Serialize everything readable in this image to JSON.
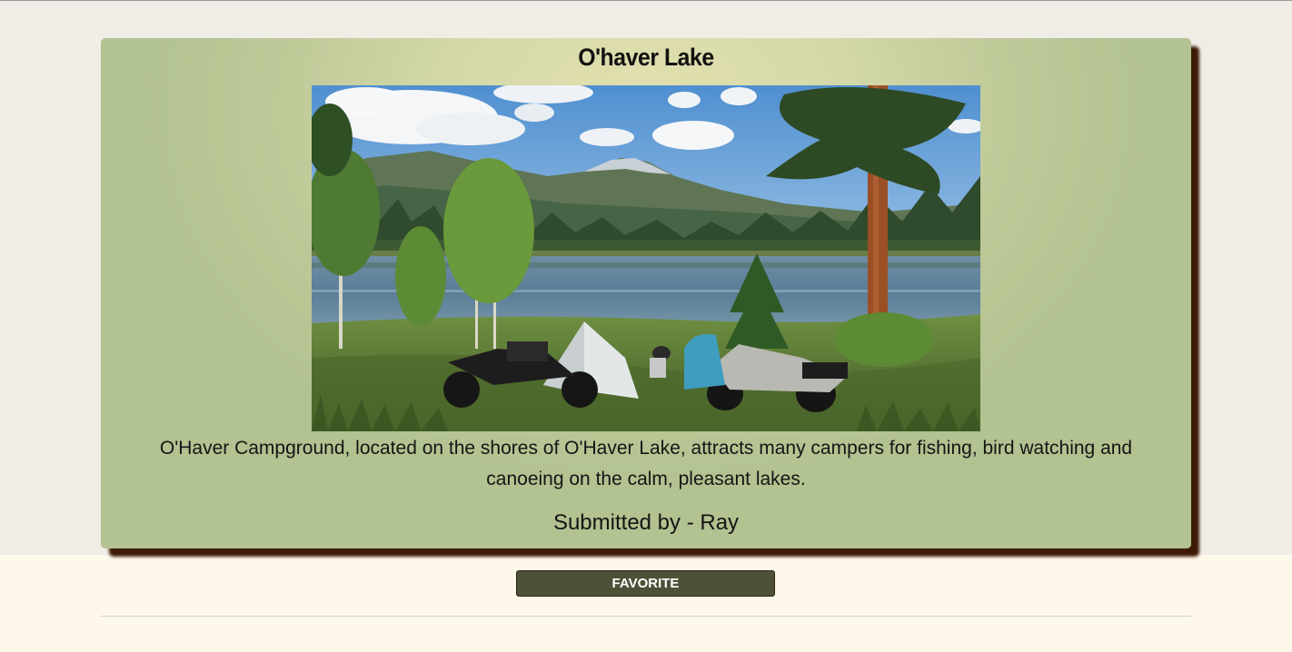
{
  "campground": {
    "title": "O'haver Lake",
    "image_alt": "Motorcycles and a tent beside O'Haver Lake with pine trees and mountains",
    "description": "O'Haver Campground, located on the shores of O'Haver Lake, attracts many campers for fishing, bird watching and canoeing on the calm, pleasant lakes.",
    "submitted_by": "Submitted by - Ray"
  },
  "actions": {
    "favorite_label": "FAVORITE"
  },
  "colors": {
    "page_background": "#f0ece6",
    "footer_background": "#fdf8ea",
    "card_center": "#e3e0af",
    "card_edge": "#b2c290",
    "card_shadow": "#3e1a05",
    "button_background": "#4d5137"
  }
}
